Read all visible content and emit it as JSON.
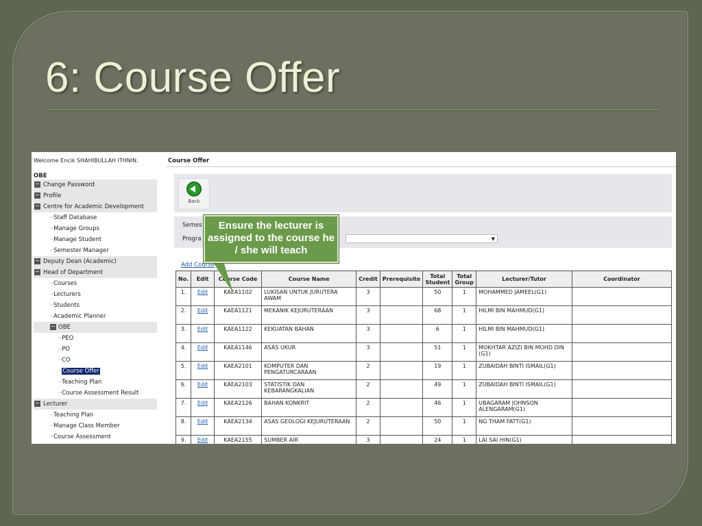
{
  "slide": {
    "title": "6: Course Offer"
  },
  "sidebar": {
    "welcome": "Welcome Encik SHAHIBULLAH ITHNIN.",
    "root": "OBE",
    "items": [
      {
        "label": "Change Password"
      },
      {
        "label": "Profile"
      },
      {
        "label": "Centre for Academic Development"
      },
      {
        "label": "Staff Database"
      },
      {
        "label": "Manage Groups"
      },
      {
        "label": "Manage Student"
      },
      {
        "label": "Semester Manager"
      },
      {
        "label": "Deputy Dean (Academic)"
      },
      {
        "label": "Head of Department"
      },
      {
        "label": "Courses"
      },
      {
        "label": "Lecturers"
      },
      {
        "label": "Students"
      },
      {
        "label": "Academic Planner"
      },
      {
        "label": "OBE"
      },
      {
        "label": "PEO"
      },
      {
        "label": "PO"
      },
      {
        "label": "CO"
      },
      {
        "label": "Course Offer"
      },
      {
        "label": "Teaching Plan"
      },
      {
        "label": "Course Assessment Result"
      },
      {
        "label": "Lecturer"
      },
      {
        "label": "Teaching Plan"
      },
      {
        "label": "Manage Class Member"
      },
      {
        "label": "Course Assessment"
      }
    ]
  },
  "main": {
    "header": "Course Offer",
    "back_label": "Back",
    "semester_label": "Semes",
    "program_label": "Progra",
    "add_course": "Add Course",
    "add_sep": "|"
  },
  "callout": {
    "text": "Ensure the lecturer is assigned to the course he / she will teach"
  },
  "table": {
    "headers": {
      "no": "No.",
      "edit": "Edit",
      "code": "Course Code",
      "code_visible": "se\nCode",
      "name": "Course Name",
      "credit": "Credit",
      "prereq": "Prerequisite",
      "total_student": "Total Student",
      "total_group": "Total Group",
      "lecturer": "Lecturer/Tutor",
      "coordinator": "Coordinator"
    },
    "edit_label": "Edit",
    "rows": [
      {
        "no": "1.",
        "code": "KAEA1102",
        "name": "LUKISAN UNTUK JURUTERA AWAM",
        "credit": "3",
        "prereq": "",
        "students": "50",
        "groups": "1",
        "lecturer": "MOHAMMED JAMEEL(G1)",
        "coordinator": ""
      },
      {
        "no": "2.",
        "code": "KAEA1121",
        "name": "MEKANIK KEJURUTERAAN",
        "credit": "3",
        "prereq": "",
        "students": "68",
        "groups": "1",
        "lecturer": "HILMI BIN MAHMUD(G1)",
        "coordinator": ""
      },
      {
        "no": "3.",
        "code": "KAEA1122",
        "name": "KEKUATAN BAHAN",
        "credit": "3",
        "prereq": "",
        "students": "6",
        "groups": "1",
        "lecturer": "HILMI BIN MAHMUD(G1)",
        "coordinator": ""
      },
      {
        "no": "4.",
        "code": "KAEA1146",
        "name": "ASAS UKUR",
        "credit": "3",
        "prereq": "",
        "students": "51",
        "groups": "1",
        "lecturer": "MOKHTAR AZIZI BIN MOHD DIN (G1)",
        "coordinator": ""
      },
      {
        "no": "5.",
        "code": "KAEA2101",
        "name": "KOMPUTER DAN PENGATURCARAAN",
        "credit": "2",
        "prereq": "",
        "students": "19",
        "groups": "1",
        "lecturer": "ZUBAIDAH BINTI ISMAIL(G1)",
        "coordinator": ""
      },
      {
        "no": "6.",
        "code": "KAEA2103",
        "name": "STATISTIK DAN KEBARANGKALIAN",
        "credit": "2",
        "prereq": "",
        "students": "49",
        "groups": "1",
        "lecturer": "ZUBAIDAH BINTI ISMAIL(G1)",
        "coordinator": ""
      },
      {
        "no": "7.",
        "code": "KAEA2126",
        "name": "BAHAN KONKRIT",
        "credit": "2",
        "prereq": "",
        "students": "46",
        "groups": "1",
        "lecturer": "UBAGARAM JOHNSON ALENGARAM(G1)",
        "coordinator": ""
      },
      {
        "no": "8.",
        "code": "KAEA2134",
        "name": "ASAS GEOLOGI KEJURUTERAAN",
        "credit": "2",
        "prereq": "",
        "students": "50",
        "groups": "1",
        "lecturer": "NG THAM FATT(G1)",
        "coordinator": ""
      },
      {
        "no": "9.",
        "code": "KAEA2155",
        "name": "SUMBER AIR",
        "credit": "3",
        "prereq": "",
        "students": "24",
        "groups": "1",
        "lecturer": "LAI SAI HIN(G1)",
        "coordinator": ""
      }
    ]
  },
  "colors": {
    "slide_bg": "#5f6553",
    "title_text": "#eef0d6",
    "callout_bg": "#6b9a4a",
    "link": "#1e5aa8",
    "selected_bg": "#0a246a"
  },
  "icons": {
    "expand": "minus-box-icon",
    "back": "back-arrow-icon",
    "dropdown": "chevron-down-icon"
  }
}
